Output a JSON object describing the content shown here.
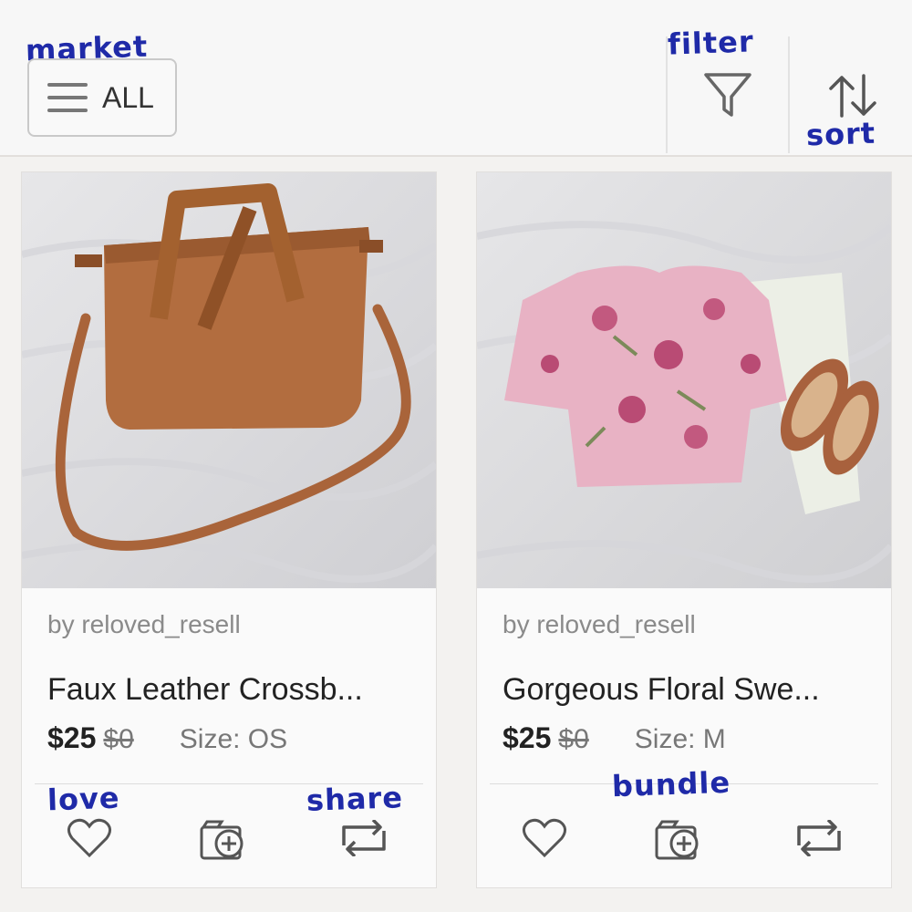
{
  "annotations": {
    "market": "market",
    "filter": "filter",
    "sort": "sort",
    "love": "love",
    "share": "share",
    "bundle": "bundle"
  },
  "header": {
    "market_label": "ALL"
  },
  "listings": [
    {
      "seller": "by reloved_resell",
      "title": "Faux Leather Crossb...",
      "price": "$25",
      "original_price": "$0",
      "size": "Size: OS"
    },
    {
      "seller": "by reloved_resell",
      "title": "Gorgeous Floral Swe...",
      "price": "$25",
      "original_price": "$0",
      "size": "Size: M"
    }
  ],
  "icons": {
    "menu": "hamburger-icon",
    "filter": "funnel-icon",
    "sort": "sort-arrows-icon",
    "love": "heart-icon",
    "bundle": "bundle-add-icon",
    "share": "share-icon"
  },
  "colors": {
    "annotation": "#1f2aa8",
    "background": "#f3f2f0",
    "card": "#fafafa"
  }
}
